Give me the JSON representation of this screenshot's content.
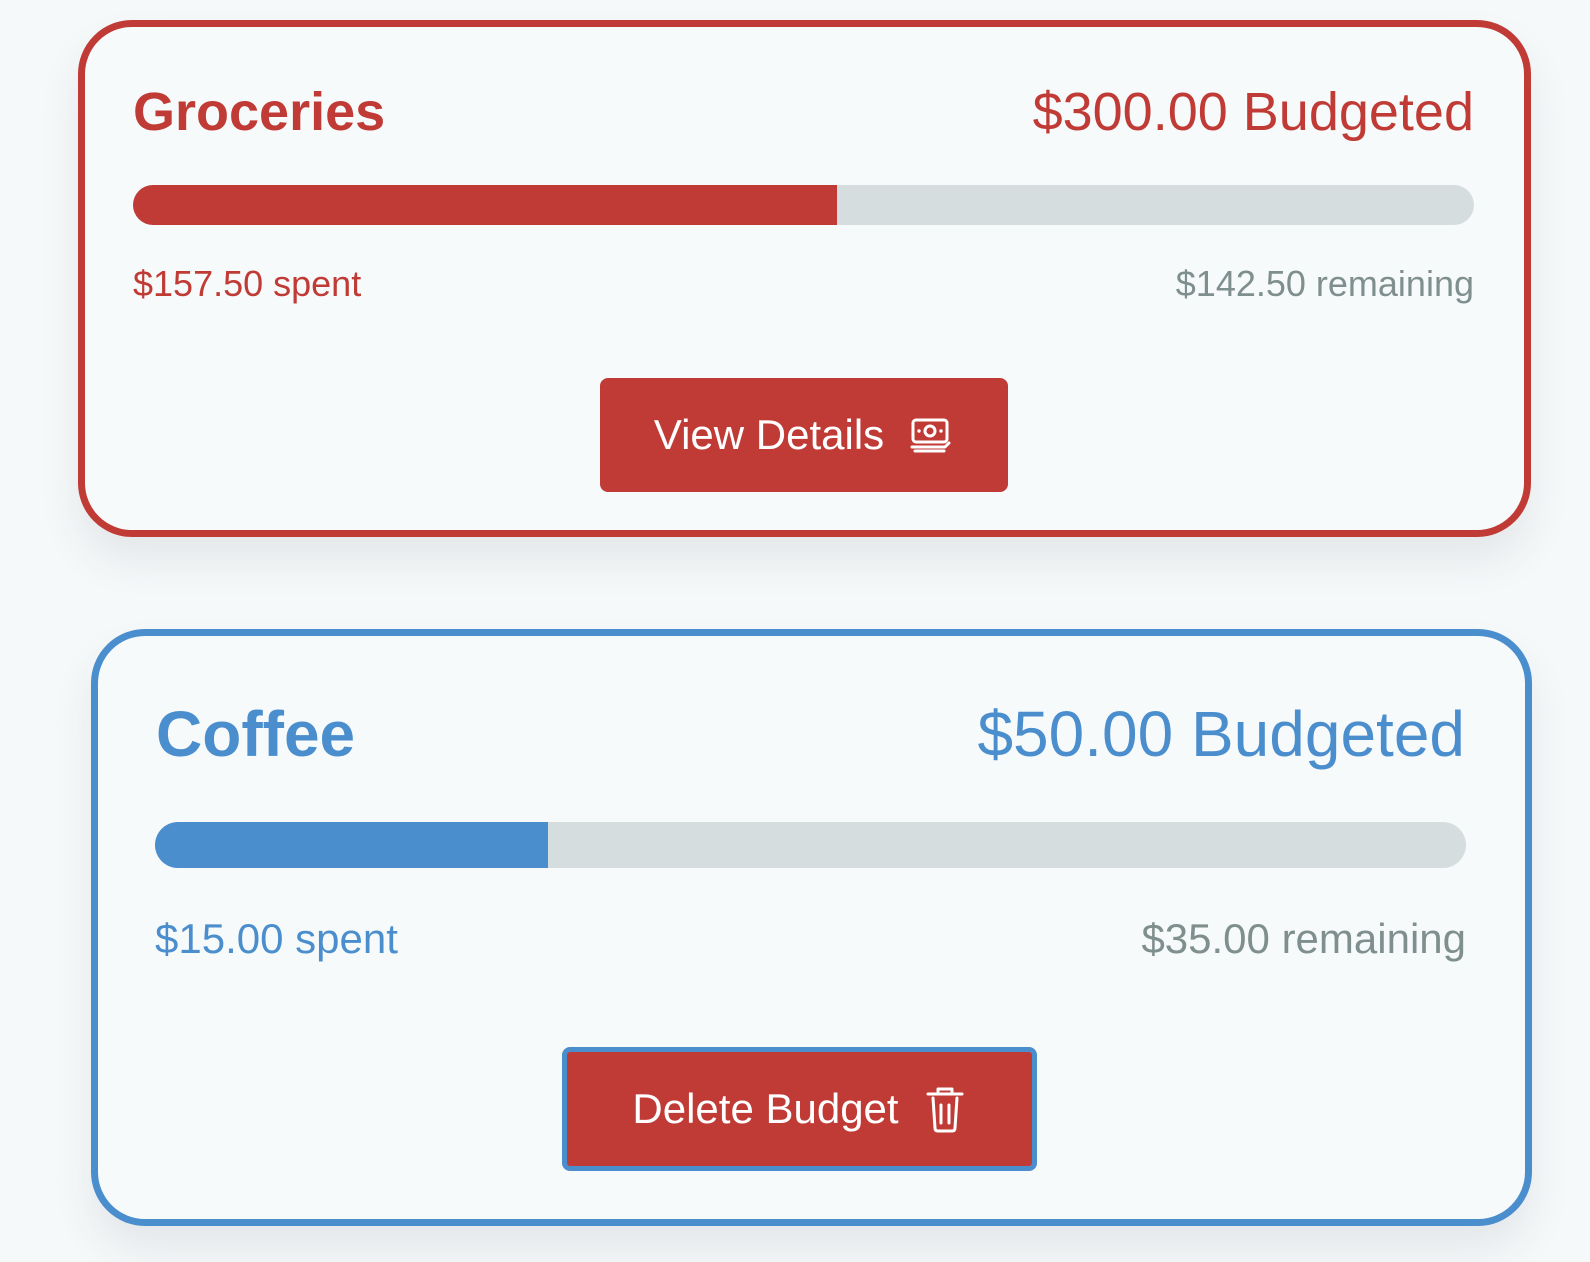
{
  "budgets": [
    {
      "title": "Groceries",
      "budgeted_text": "$300.00 Budgeted",
      "spent_text": "$157.50 spent",
      "remaining_text": "$142.50 remaining",
      "progress_percent": 52.5,
      "accent_color": "#c13b36",
      "action": {
        "label": "View Details",
        "icon": "banknotes-icon"
      }
    },
    {
      "title": "Coffee",
      "budgeted_text": "$50.00 Budgeted",
      "spent_text": "$15.00 spent",
      "remaining_text": "$35.00 remaining",
      "progress_percent": 30,
      "accent_color": "#4b8ecd",
      "action": {
        "label": "Delete Budget",
        "icon": "trash-icon"
      }
    }
  ],
  "colors": {
    "page_background": "#f6f9fa",
    "progress_track": "#d6dddf",
    "remaining_text": "#7f8f8d",
    "button_background": "#c13b36"
  }
}
